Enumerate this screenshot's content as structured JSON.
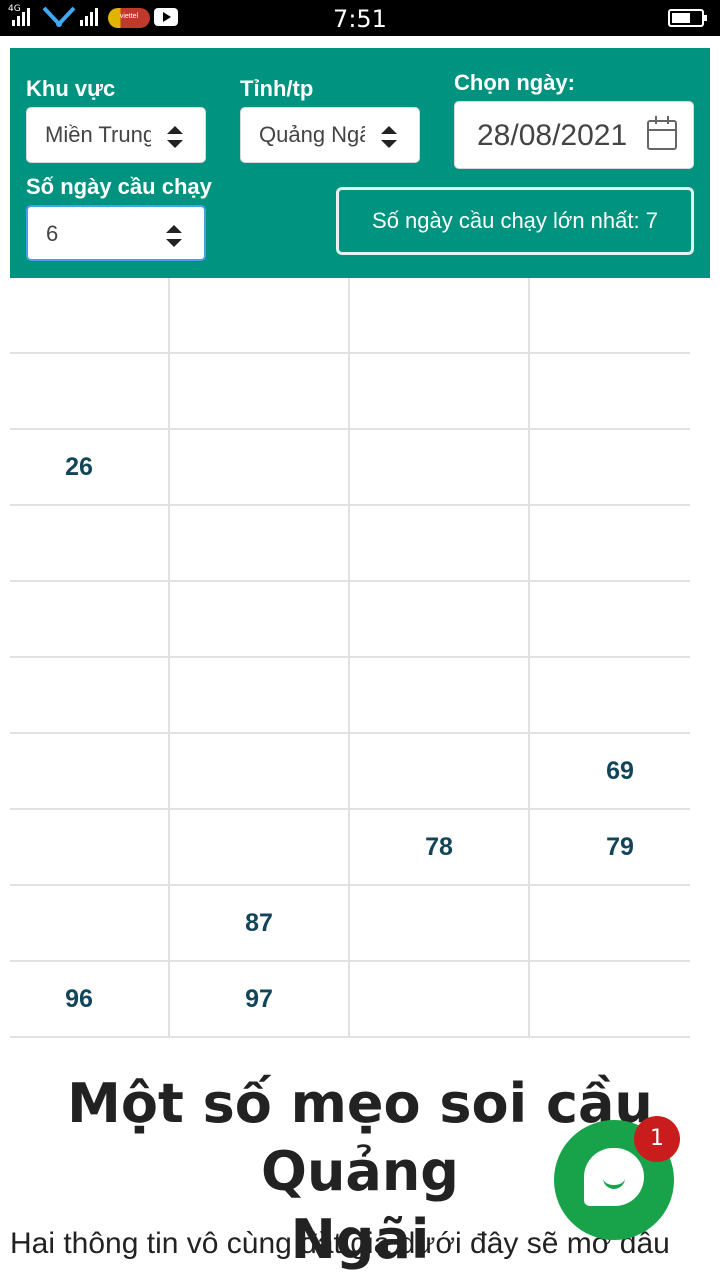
{
  "status_bar": {
    "time": "7:51",
    "network": "4G",
    "carrier": "viettel"
  },
  "filters": {
    "region_label": "Khu vực",
    "region_value": "Miền Trung",
    "province_label": "Tỉnh/tp",
    "province_value": "Quảng Ngãi",
    "date_label": "Chọn ngày:",
    "date_value": "28/08/2021",
    "days_label": "Số ngày cầu chạy",
    "days_value": "6",
    "max_days_text": "Số ngày cầu chạy lớn nhất: 7"
  },
  "grid": {
    "rows": [
      [
        "",
        "",
        "",
        ""
      ],
      [
        "",
        "",
        "",
        ""
      ],
      [
        "26",
        "",
        "",
        ""
      ],
      [
        "",
        "",
        "",
        ""
      ],
      [
        "",
        "",
        "",
        ""
      ],
      [
        "",
        "",
        "",
        ""
      ],
      [
        "",
        "",
        "",
        "69"
      ],
      [
        "",
        "",
        "78",
        "79"
      ],
      [
        "",
        "87",
        "",
        ""
      ],
      [
        "96",
        "97",
        "",
        ""
      ]
    ]
  },
  "article": {
    "title_line1": "Một số mẹo soi cầu Quảng",
    "title_line2": "Ngãi",
    "intro": "Hai thông tin vô cùng đắt giá dưới đây sẽ mở đầu"
  },
  "chat": {
    "badge_count": "1"
  }
}
